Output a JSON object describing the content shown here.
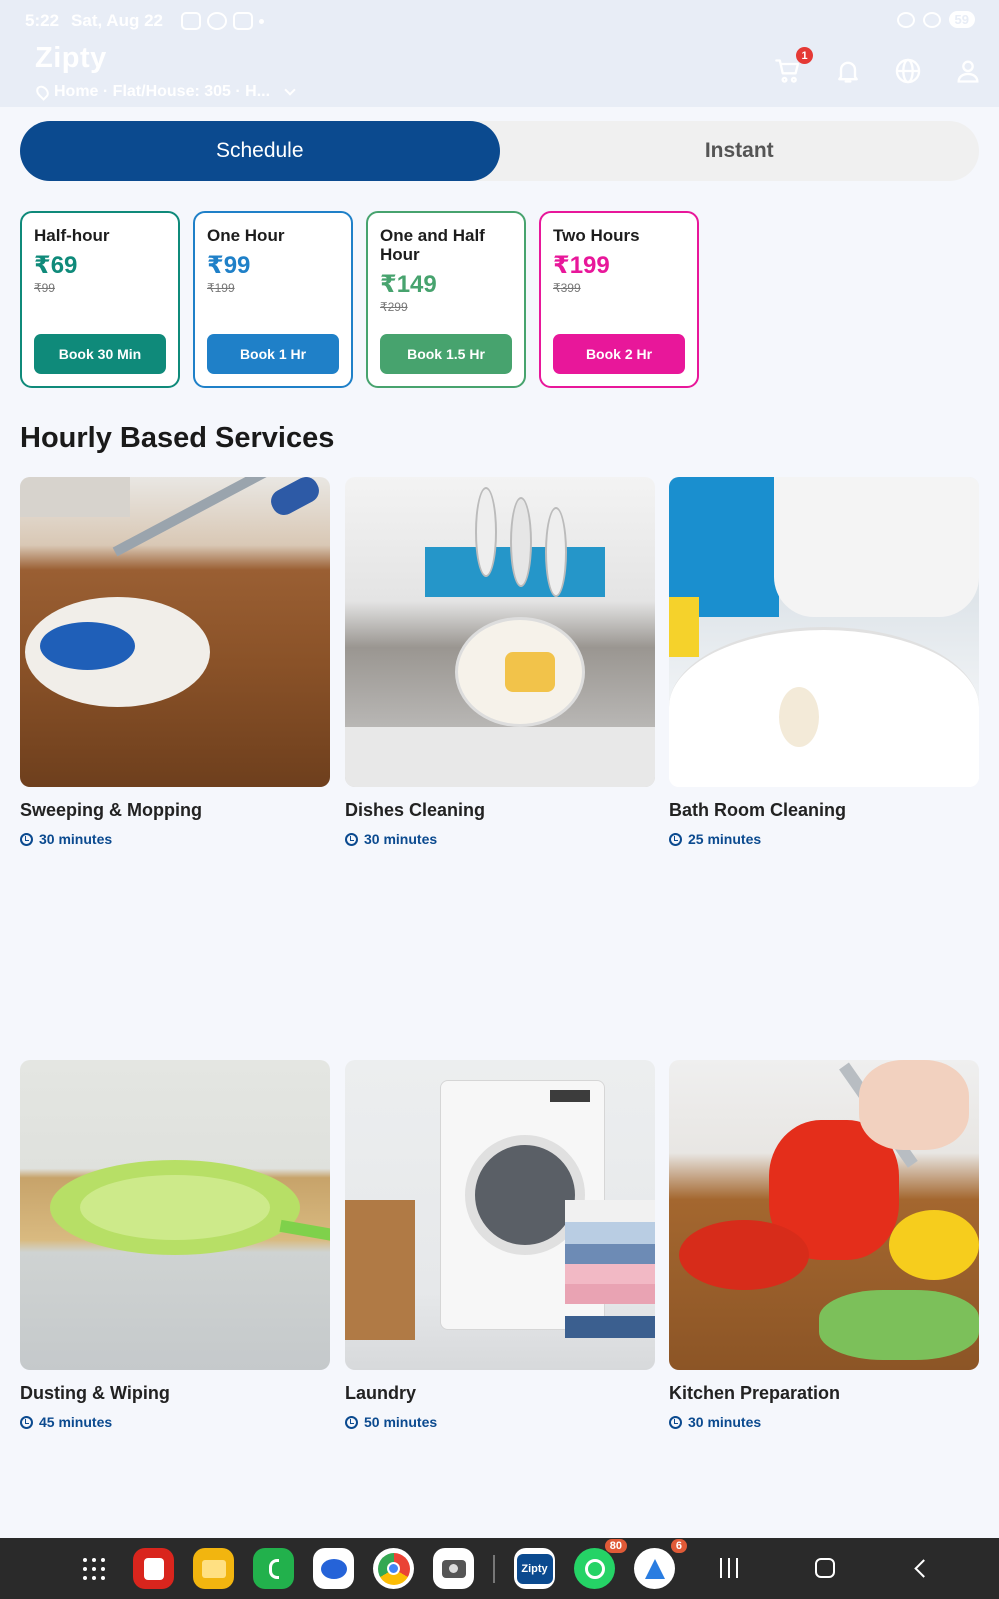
{
  "status_bar": {
    "time": "5:22",
    "date": "Sat, Aug 22",
    "battery": "59"
  },
  "header": {
    "brand": "Zipty",
    "address": "Home · Flat/House: 305 · H...",
    "cart_count": "1"
  },
  "tabs": [
    {
      "label": "Schedule",
      "active": true
    },
    {
      "label": "Instant",
      "active": false
    }
  ],
  "plans": [
    {
      "title": "Half-hour",
      "price": "₹69",
      "old_price": "₹99",
      "button": "Book 30 Min",
      "color": "#0f8a7a"
    },
    {
      "title": "One Hour",
      "price": "₹99",
      "old_price": "₹199",
      "button": "Book 1 Hr",
      "color": "#1f80c8"
    },
    {
      "title": "One and Half Hour",
      "price": "₹149",
      "old_price": "₹299",
      "button": "Book 1.5 Hr",
      "color": "#47a36e"
    },
    {
      "title": "Two Hours",
      "price": "₹199",
      "old_price": "₹399",
      "button": "Book 2 Hr",
      "color": "#e8179a"
    }
  ],
  "section_title": "Hourly Based Services",
  "services": [
    {
      "name": "Sweeping & Mopping",
      "duration": "30 minutes"
    },
    {
      "name": "Dishes Cleaning",
      "duration": "30 minutes"
    },
    {
      "name": "Bath Room Cleaning",
      "duration": "25 minutes"
    },
    {
      "name": "Dusting & Wiping",
      "duration": "45 minutes"
    },
    {
      "name": "Laundry",
      "duration": "50 minutes"
    },
    {
      "name": "Kitchen Preparation",
      "duration": "30 minutes"
    }
  ],
  "dock": {
    "apps": [
      {
        "name": "apps-drawer"
      },
      {
        "name": "notes-app",
        "color": "#d9251d"
      },
      {
        "name": "files-app",
        "color": "#f2b50f"
      },
      {
        "name": "phone-app",
        "color": "#22b14c"
      },
      {
        "name": "messages-app",
        "color": "#ffffff"
      },
      {
        "name": "chrome-app",
        "color": "#ffffff"
      },
      {
        "name": "camera-app",
        "color": "#ffffff"
      },
      {
        "name": "zipty-app",
        "color": "#ffffff",
        "label": "Zipty"
      },
      {
        "name": "whatsapp-app",
        "color": "#25d366",
        "badge": "80"
      },
      {
        "name": "maps-app",
        "color": "#ffffff",
        "badge": "6"
      }
    ]
  }
}
